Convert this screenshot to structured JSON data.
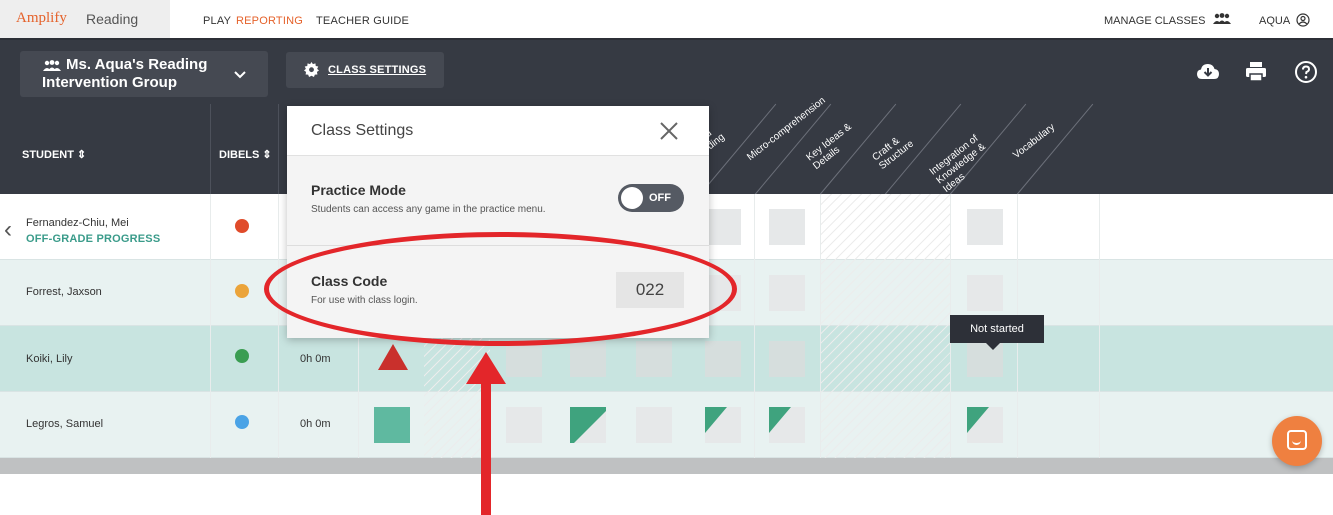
{
  "nav": {
    "brand_name": "Amplify",
    "product": "Reading",
    "links": [
      "PLAY",
      "REPORTING",
      "TEACHER GUIDE"
    ],
    "active_link": "REPORTING",
    "manage_classes": "MANAGE CLASSES",
    "user": "AQUA"
  },
  "toolbar": {
    "class_name": "Ms. Aqua's Reading Intervention Group",
    "class_settings": "CLASS SETTINGS"
  },
  "table": {
    "header_student": "STUDENT ⇕",
    "header_dibels": "DIBELS ⇕",
    "skill_columns": [
      "Guided Reading",
      "Micro-comprehension",
      "Key Ideas & Details",
      "Craft & Structure",
      "Integration of Knowledge & Ideas",
      "Vocabulary"
    ],
    "skill_partial_labels": [
      "ed",
      "ding"
    ],
    "rows": [
      {
        "name": "Fernandez-Chiu, Mei",
        "status": "OFF-GRADE PROGRESS",
        "dibels_color": "#e04b2a",
        "time": ""
      },
      {
        "name": "Forrest, Jaxson",
        "status": "",
        "dibels_color": "#eba43a",
        "time": ""
      },
      {
        "name": "Koiki, Lily",
        "status": "",
        "dibels_color": "#3a9d52",
        "time": "0h 0m"
      },
      {
        "name": "Legros, Samuel",
        "status": "",
        "dibels_color": "#4aa3e6",
        "time": "0h 0m"
      }
    ]
  },
  "popup": {
    "title": "Class Settings",
    "practice_mode": {
      "title": "Practice Mode",
      "description": "Students can access any game in the practice menu.",
      "toggle": "OFF"
    },
    "class_code": {
      "title": "Class Code",
      "description": "For use with class login.",
      "value": "022"
    }
  },
  "tooltip": "Not started",
  "colors": {
    "accent": "#e5622b",
    "teal": "#3a9b8a",
    "annotation_red": "#e3262a",
    "toolbar": "#363a43"
  }
}
